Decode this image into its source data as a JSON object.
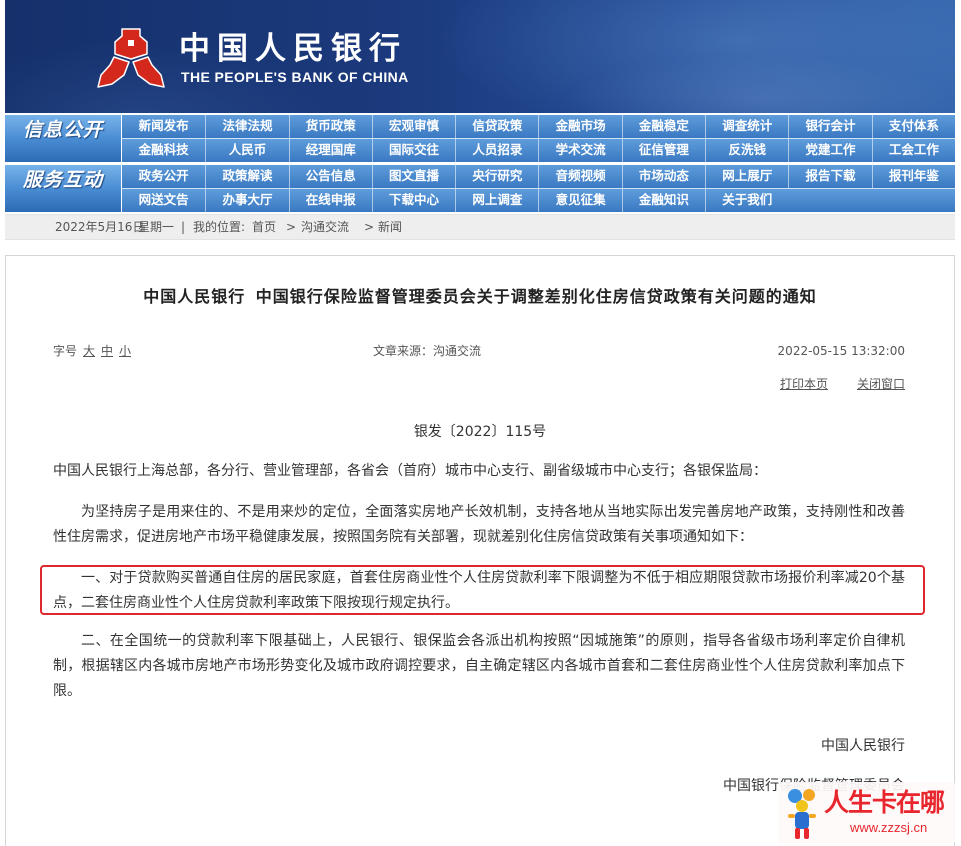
{
  "header": {
    "title_cn": "中国人民银行",
    "title_en": "THE PEOPLE'S BANK OF CHINA",
    "logo_icon": "pboc-emblem-icon"
  },
  "nav": {
    "groups": [
      {
        "label": "信息公开",
        "rows": [
          [
            "新闻发布",
            "法律法规",
            "货币政策",
            "宏观审慎",
            "信贷政策",
            "金融市场",
            "金融稳定",
            "调查统计",
            "银行会计",
            "支付体系"
          ],
          [
            "金融科技",
            "人民币",
            "经理国库",
            "国际交往",
            "人员招录",
            "学术交流",
            "征信管理",
            "反洗钱",
            "党建工作",
            "工会工作"
          ]
        ]
      },
      {
        "label": "服务互动",
        "rows": [
          [
            "政务公开",
            "政策解读",
            "公告信息",
            "图文直播",
            "央行研究",
            "音频视频",
            "市场动态",
            "网上展厅",
            "报告下载",
            "报刊年鉴"
          ],
          [
            "网送文告",
            "办事大厅",
            "在线申报",
            "下载中心",
            "网上调查",
            "意见征集",
            "金融知识",
            "关于我们"
          ]
        ]
      }
    ]
  },
  "breadcrumb": {
    "date": "2022年5月16日",
    "weekday": "星期一",
    "divider": "|",
    "location_label": "我的位置:",
    "home": "首页",
    "arrow": ">",
    "section": "沟通交流",
    "current": "新闻"
  },
  "article": {
    "title": "中国人民银行 中国银行保险监督管理委员会关于调整差别化住房信贷政策有关问题的通知",
    "font_size_label": "字号",
    "font_size_large": "大",
    "font_size_medium": "中",
    "font_size_small": "小",
    "source_label": "文章来源：",
    "source": "沟通交流",
    "published": "2022-05-15 13:32:00",
    "print_label": "打印本页",
    "close_label": "关闭窗口",
    "doc_number": "银发〔2022〕115号",
    "salutation": "中国人民银行上海总部，各分行、营业管理部，各省会（首府）城市中心支行、副省级城市中心支行；各银保监局：",
    "paragraphs": [
      {
        "lines": [
          "为坚持房子是用来住的、不是用来炒的定位，全面落实房地产长效机制，支持各地从当地实际出发完善房地产政策，支持刚性和改善",
          "性住房需求，促进房地产市场平稳健康发展，按照国务院有关部署，现就差别化住房信贷政策有关事项通知如下："
        ]
      },
      {
        "highlighted": true,
        "lines": [
          "一、对于贷款购买普通自住房的居民家庭，首套住房商业性个人住房贷款利率下限调整为不低于相应期限贷款市场报价利率减20个基",
          "点，二套住房商业性个人住房贷款利率政策下限按现行规定执行。"
        ]
      },
      {
        "lines": [
          "二、在全国统一的贷款利率下限基础上，人民银行、银保监会各派出机构按照“因城施策”的原则，指导各省级市场利率定价自律机",
          "制，根据辖区内各城市房地产市场形势变化及城市政府调控要求，自主确定辖区内各城市首套和二套住房商业性个人住房贷款利率加点下",
          "限。"
        ]
      }
    ],
    "signatures": [
      "中国人民银行",
      "中国银行保险监督管理委员会"
    ]
  },
  "watermark": {
    "text": "人生卡在哪",
    "url": "www.zzzsj.cn",
    "icon": "cartoon-figure-icon"
  },
  "colors": {
    "header_dark": "#15306b",
    "header_light": "#3566ad",
    "nav_blue": "#3a79c2",
    "highlight_border": "#e0282c",
    "watermark_red": "#e8262d",
    "body_text": "#333333"
  }
}
